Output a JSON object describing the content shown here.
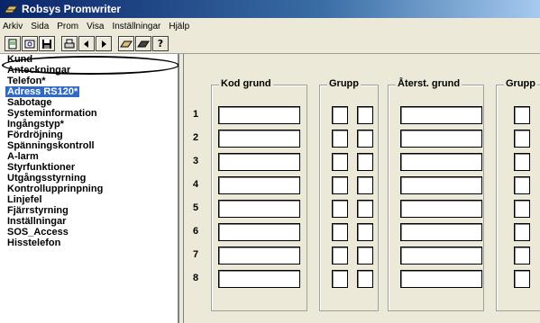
{
  "window": {
    "title": "Robsys Promwriter"
  },
  "menu": [
    "Arkiv",
    "Sida",
    "Prom",
    "Visa",
    "Inställningar",
    "Hjälp"
  ],
  "toolbar": {
    "buttons": [
      {
        "name": "new-icon",
        "glyph": "▤"
      },
      {
        "name": "open-icon",
        "glyph": "▣"
      },
      {
        "name": "save-icon",
        "glyph": "▦"
      },
      {
        "name": "print-icon",
        "glyph": "⎙"
      },
      {
        "name": "prev-icon",
        "glyph": "◀"
      },
      {
        "name": "next-icon",
        "glyph": "▶"
      },
      {
        "name": "chip-read-icon",
        "glyph": "▰"
      },
      {
        "name": "chip-write-icon",
        "glyph": "▰"
      },
      {
        "name": "help-icon",
        "glyph": "?"
      }
    ]
  },
  "sidebar": {
    "items": [
      "Kund",
      "Anteckningar",
      "Telefon*",
      "Adress RS120*",
      "Sabotage",
      "Systeminformation",
      "Ingångstyp*",
      "Fördröjning",
      "Spänningskontroll",
      "A-larm",
      "Styrfunktioner",
      "Utgångsstyrning",
      "Kontrollupprinpning",
      "Linjefel",
      "Fjärrstyrning",
      "Inställningar",
      "SOS_Access",
      "Hisstelefon"
    ],
    "selected_index": 3
  },
  "form": {
    "groups": {
      "kod_grund": "Kod grund",
      "grupp": "Grupp",
      "aterst_grund": "Återst. grund",
      "grupp2": "Grupp"
    },
    "rows": [
      "1",
      "2",
      "3",
      "4",
      "5",
      "6",
      "7",
      "8"
    ]
  }
}
